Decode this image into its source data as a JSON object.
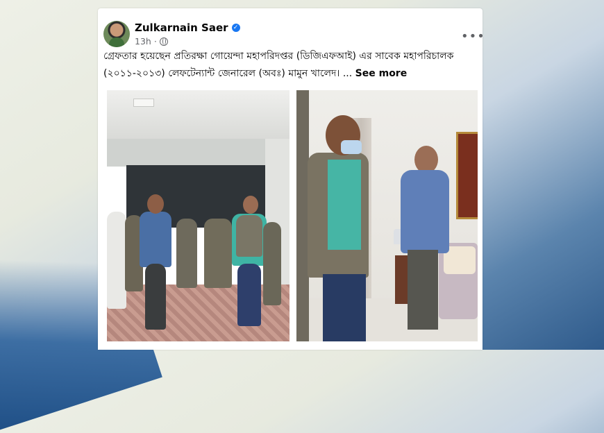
{
  "post": {
    "author": "Zulkarnain Saer",
    "time": "13h",
    "caption": "গ্রেফতার হয়েছেন প্রতিরক্ষা গোয়েন্দা মহাপরিদপ্তর (ডিজিএফআই) এর সাবেক মহাপরিচালক (২০১১-২০১৩) লেফটেন্যান্ট জেনারেল (অবঃ) মামুন খালেদ। ...",
    "see_more": "See more",
    "more_icon": "•••",
    "verified_glyph": "✓"
  },
  "icons": {
    "verified": "verified-badge-icon",
    "audience": "globe-icon",
    "more": "more-options-icon"
  },
  "colors": {
    "verified": "#1877f2",
    "meta_text": "#65676b"
  }
}
